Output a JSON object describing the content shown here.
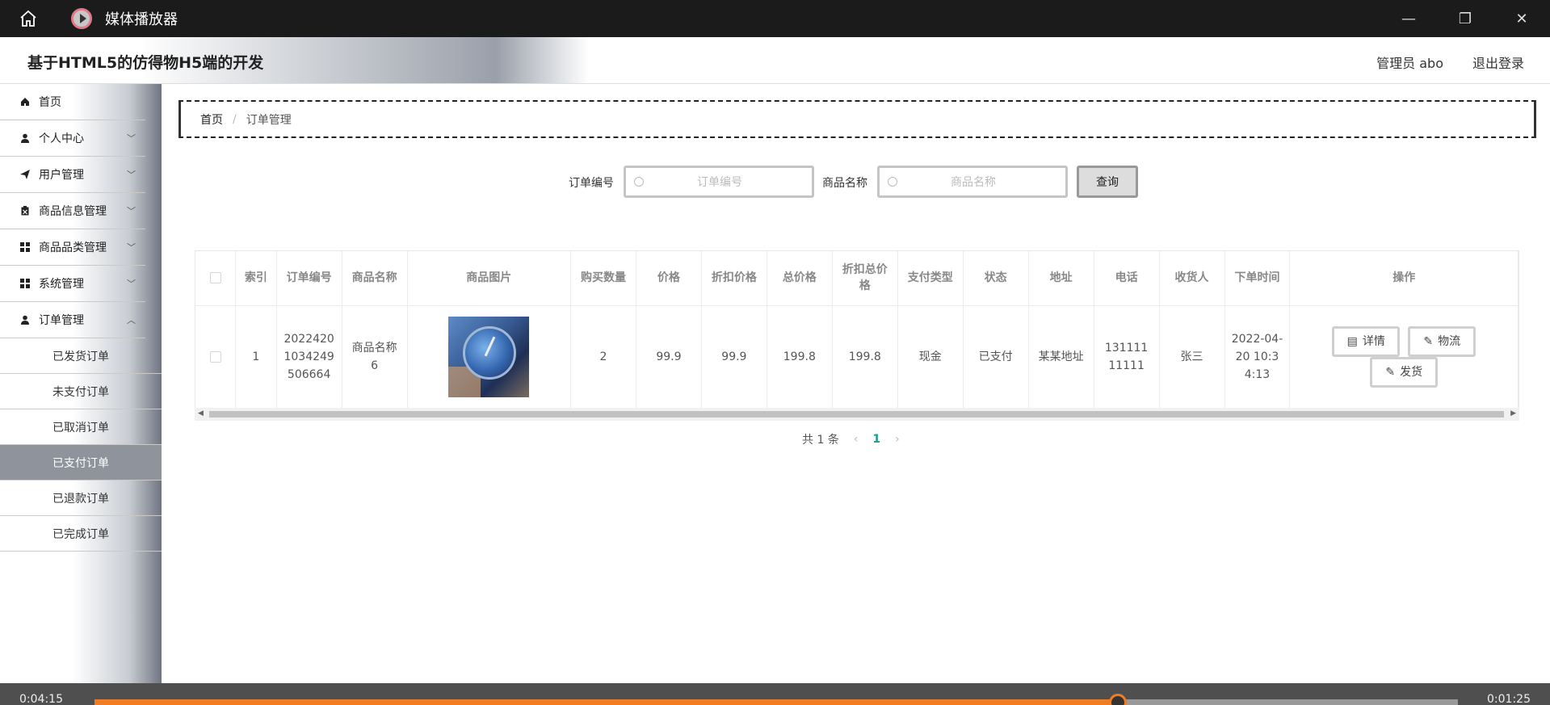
{
  "player": {
    "title": "媒体播放器",
    "elapsed": "0:04:15",
    "remaining": "0:01:25",
    "progress": 0.7507
  },
  "header": {
    "site_title": "基于HTML5的仿得物H5端的开发",
    "user": "管理员 abo",
    "logout": "退出登录"
  },
  "sidebar": {
    "items": [
      {
        "label": "首页",
        "icon": "home-icon",
        "chevron": false
      },
      {
        "label": "个人中心",
        "icon": "user-icon",
        "chevron": true
      },
      {
        "label": "用户管理",
        "icon": "send-icon",
        "chevron": true
      },
      {
        "label": "商品信息管理",
        "icon": "clipboard-icon",
        "chevron": true
      },
      {
        "label": "商品品类管理",
        "icon": "grid-icon",
        "chevron": true
      },
      {
        "label": "系统管理",
        "icon": "grid-icon",
        "chevron": true
      },
      {
        "label": "订单管理",
        "icon": "user-icon",
        "chevron": true
      }
    ],
    "sub_items": [
      "已发货订单",
      "未支付订单",
      "已取消订单",
      "已支付订单",
      "已退款订单",
      "已完成订单"
    ],
    "active_sub": "已支付订单"
  },
  "breadcrumb": {
    "home": "首页",
    "separator": "/",
    "current": "订单管理"
  },
  "search": {
    "order_label": "订单编号",
    "order_placeholder": "订单编号",
    "product_label": "商品名称",
    "product_placeholder": "商品名称",
    "button": "查询"
  },
  "table": {
    "headers": [
      "索引",
      "订单编号",
      "商品名称",
      "商品图片",
      "购买数量",
      "价格",
      "折扣价格",
      "总价格",
      "折扣总价格",
      "支付类型",
      "状态",
      "地址",
      "电话",
      "收货人",
      "下单时间",
      "操作"
    ],
    "rows": [
      {
        "index": "1",
        "order_no": "20224201034249506664",
        "product_name": "商品名称6",
        "quantity": "2",
        "price": "99.9",
        "discount_price": "99.9",
        "total": "199.8",
        "discount_total": "199.8",
        "pay_type": "现金",
        "status": "已支付",
        "address": "某某地址",
        "phone": "13111111111",
        "receiver": "张三",
        "time": "2022-04-20 10:34:13"
      }
    ],
    "actions": [
      "详情",
      "物流",
      "发货"
    ]
  },
  "pager": {
    "total": "共 1 条",
    "page": "1"
  }
}
